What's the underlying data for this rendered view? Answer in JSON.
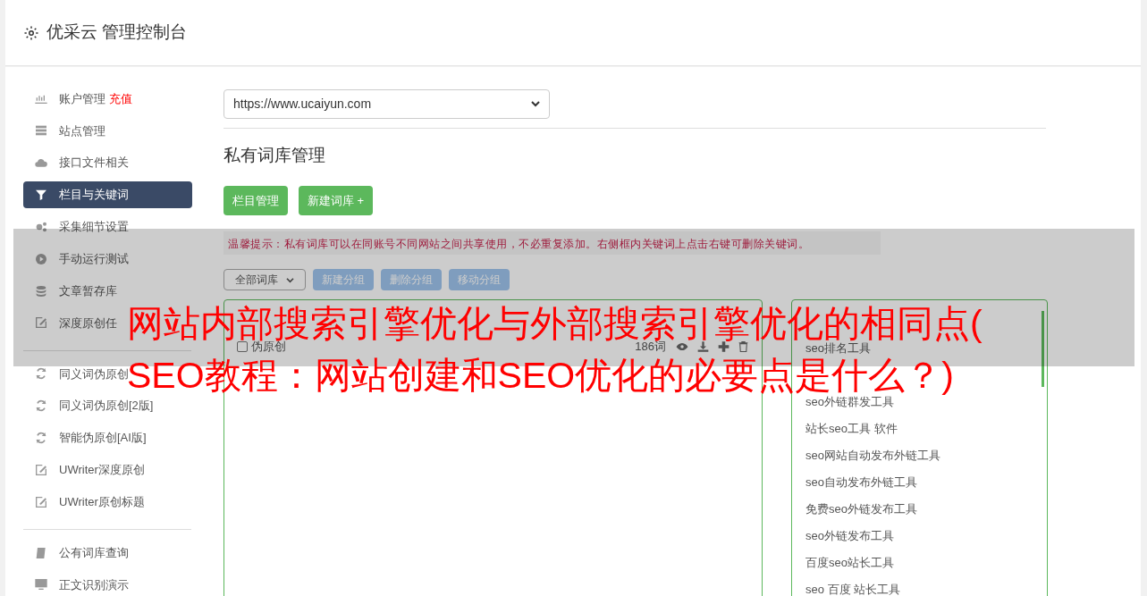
{
  "header": {
    "title": "优采云 管理控制台"
  },
  "sidebar": {
    "groups": [
      {
        "items": [
          {
            "label": "账户管理",
            "badge": "充值",
            "selected": false
          },
          {
            "label": "站点管理",
            "selected": false
          },
          {
            "label": "接口文件相关",
            "selected": false
          },
          {
            "label": "栏目与关键词",
            "selected": true
          },
          {
            "label": "采集细节设置",
            "selected": false
          },
          {
            "label": "手动运行测试",
            "selected": false
          },
          {
            "label": "文章暂存库",
            "selected": false
          },
          {
            "label": "深度原创任",
            "selected": false
          }
        ]
      },
      {
        "items": [
          {
            "label": "同义词伪原创",
            "selected": false
          },
          {
            "label": "同义词伪原创[2版]",
            "selected": false
          },
          {
            "label": "智能伪原创[AI版]",
            "selected": false
          },
          {
            "label": "UWriter深度原创",
            "selected": false
          },
          {
            "label": "UWriter原创标题",
            "selected": false
          }
        ]
      },
      {
        "items": [
          {
            "label": "公有词库查询",
            "selected": false
          },
          {
            "label": "正文识别演示",
            "selected": false
          }
        ]
      }
    ]
  },
  "site_select": {
    "value": "https://www.ucaiyun.com"
  },
  "heading": "私有词库管理",
  "buttons": [
    "栏目管理",
    "新建词库 +"
  ],
  "tip": "温馨提示：私有词库可以在同账号不同网站之间共享使用，不必重复添加。右侧框内关键词上点击右键可删除关键词。",
  "toolbar": {
    "filter": "全部词库",
    "buttons": [
      "新建分组",
      "删除分组",
      "移动分组"
    ]
  },
  "libraries": [
    {
      "label": "伪原创",
      "count": "186词",
      "checked": false
    }
  ],
  "keywords_top": [
    "seo排名工具"
  ],
  "keywords": [
    "seo外链群发工具",
    "站长seo工具 软件",
    "seo网站自动发布外链工具",
    "seo自动发布外链工具",
    "免费seo外链发布工具",
    "seo外链发布工具",
    "百度seo站长工具",
    "seo 百度 站长工具"
  ],
  "overlay_title_lines": [
    "网站内部搜索引擎优化与外部搜索引擎优化的相同点(",
    "SEO教程：网站创建和SEO优化的必要点是什么？)"
  ]
}
